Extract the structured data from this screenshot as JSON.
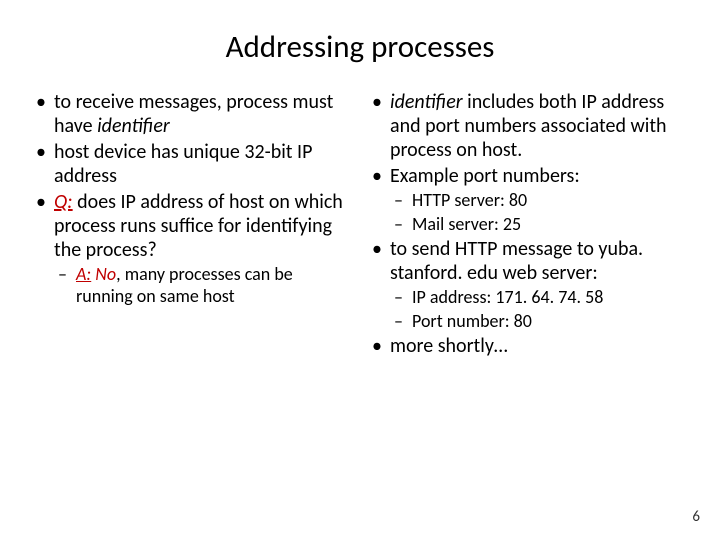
{
  "title": "Addressing processes",
  "left": {
    "b1": {
      "pre": "to receive messages, process  must have ",
      "identifier": "identifier"
    },
    "b2": "host device has unique 32-bit IP address",
    "b3": {
      "q": "Q:",
      "text": " does  IP address of host on which process runs suffice for identifying the process?"
    },
    "b3a": {
      "a": "A:",
      "no": " No",
      "rest": ", many processes can be running on same host"
    }
  },
  "right": {
    "b1": {
      "identifier": "identifier",
      "rest": " includes both IP address and port numbers associated with process on host."
    },
    "b2": "Example port numbers:",
    "b2a": "HTTP server: 80",
    "b2b": "Mail server: 25",
    "b3": "to send HTTP message to yuba. stanford. edu web server:",
    "b3a": "IP address: 171. 64. 74. 58",
    "b3b": "Port number: 80",
    "b4": "more shortly…"
  },
  "page_number": "6"
}
